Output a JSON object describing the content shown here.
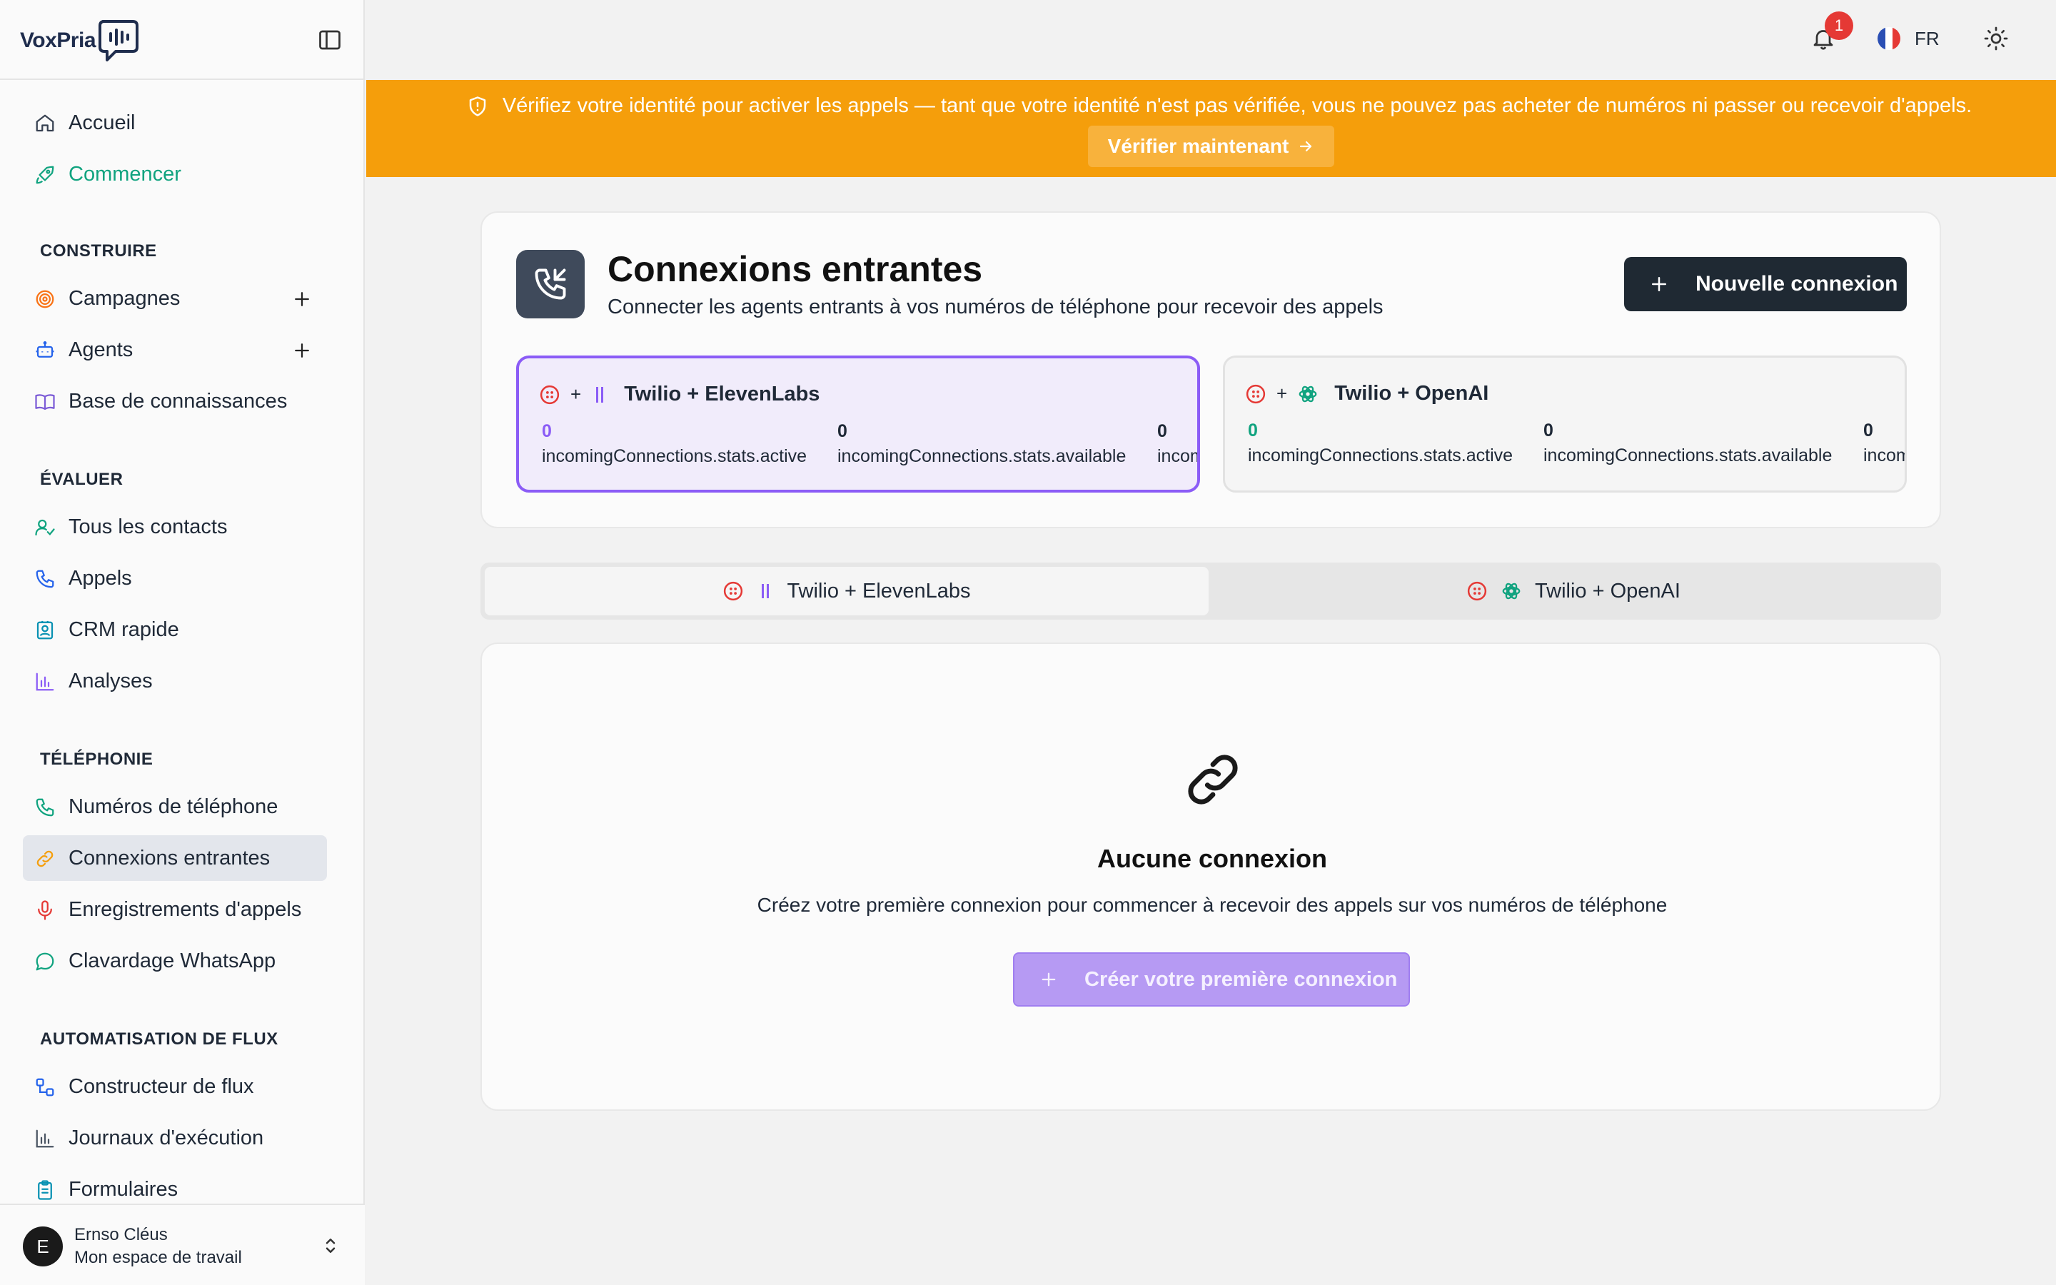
{
  "app": {
    "logo_text": "VoxPria"
  },
  "sidebar": {
    "items_top": [
      {
        "label": "Accueil",
        "icon": "home-icon"
      },
      {
        "label": "Commencer",
        "icon": "rocket-icon"
      }
    ],
    "sections": {
      "construire": "CONSTRUIRE",
      "evaluer": "ÉVALUER",
      "telephonie": "TÉLÉPHONIE",
      "automatisation": "AUTOMATISATION DE FLUX"
    },
    "construire": [
      {
        "label": "Campagnes",
        "icon": "target-icon"
      },
      {
        "label": "Agents",
        "icon": "bot-icon"
      },
      {
        "label": "Base de connaissances",
        "icon": "book-icon"
      }
    ],
    "evaluer": [
      {
        "label": "Tous les contacts",
        "icon": "user-check-icon"
      },
      {
        "label": "Appels",
        "icon": "phone-icon"
      },
      {
        "label": "CRM rapide",
        "icon": "contact-card-icon"
      },
      {
        "label": "Analyses",
        "icon": "bar-chart-icon"
      }
    ],
    "telephonie": [
      {
        "label": "Numéros de téléphone",
        "icon": "phone-icon"
      },
      {
        "label": "Connexions entrantes",
        "icon": "link-icon"
      },
      {
        "label": "Enregistrements d'appels",
        "icon": "mic-icon"
      },
      {
        "label": "Clavardage WhatsApp",
        "icon": "chat-icon"
      }
    ],
    "automatisation": [
      {
        "label": "Constructeur de flux",
        "icon": "workflow-icon"
      },
      {
        "label": "Journaux d'exécution",
        "icon": "bar-chart-icon"
      },
      {
        "label": "Formulaires",
        "icon": "clipboard-icon"
      }
    ],
    "user": {
      "initial": "E",
      "name": "Ernso Cléus",
      "workspace": "Mon espace de travail"
    }
  },
  "topbar": {
    "notifications": "1",
    "language": "FR"
  },
  "banner": {
    "text": "Vérifiez votre identité pour activer les appels — tant que votre identité n'est pas vérifiée, vous ne pouvez pas acheter de numéros ni passer ou recevoir d'appels.",
    "button": "Vérifier maintenant"
  },
  "page": {
    "title": "Connexions entrantes",
    "subtitle": "Connecter les agents entrants à vos numéros de téléphone pour recevoir des appels",
    "new_button": "Nouvelle connexion"
  },
  "providers": [
    {
      "name": "Twilio + ElevenLabs",
      "plus": "+",
      "stats": [
        {
          "value": "0",
          "label": "incomingConnections.stats.active"
        },
        {
          "value": "0",
          "label": "incomingConnections.stats.available"
        },
        {
          "value": "0",
          "label": "incomingConnections.stats.total"
        }
      ]
    },
    {
      "name": "Twilio + OpenAI",
      "plus": "+",
      "stats": [
        {
          "value": "0",
          "label": "incomingConnections.stats.active"
        },
        {
          "value": "0",
          "label": "incomingConnections.stats.available"
        },
        {
          "value": "0",
          "label": "incomingConnections.stats.total"
        }
      ]
    }
  ],
  "tabs": [
    "Twilio + ElevenLabs",
    "Twilio + OpenAI"
  ],
  "empty": {
    "title": "Aucune connexion",
    "subtitle": "Créez votre première connexion pour commencer à recevoir des appels sur vos numéros de téléphone",
    "button": "Créer votre première connexion"
  },
  "colors": {
    "banner": "#f59e0b",
    "accent_purple": "#8b5cf6",
    "accent_green": "#10a37f",
    "twilio_red": "#e53935",
    "primary_dark": "#1f2933"
  }
}
